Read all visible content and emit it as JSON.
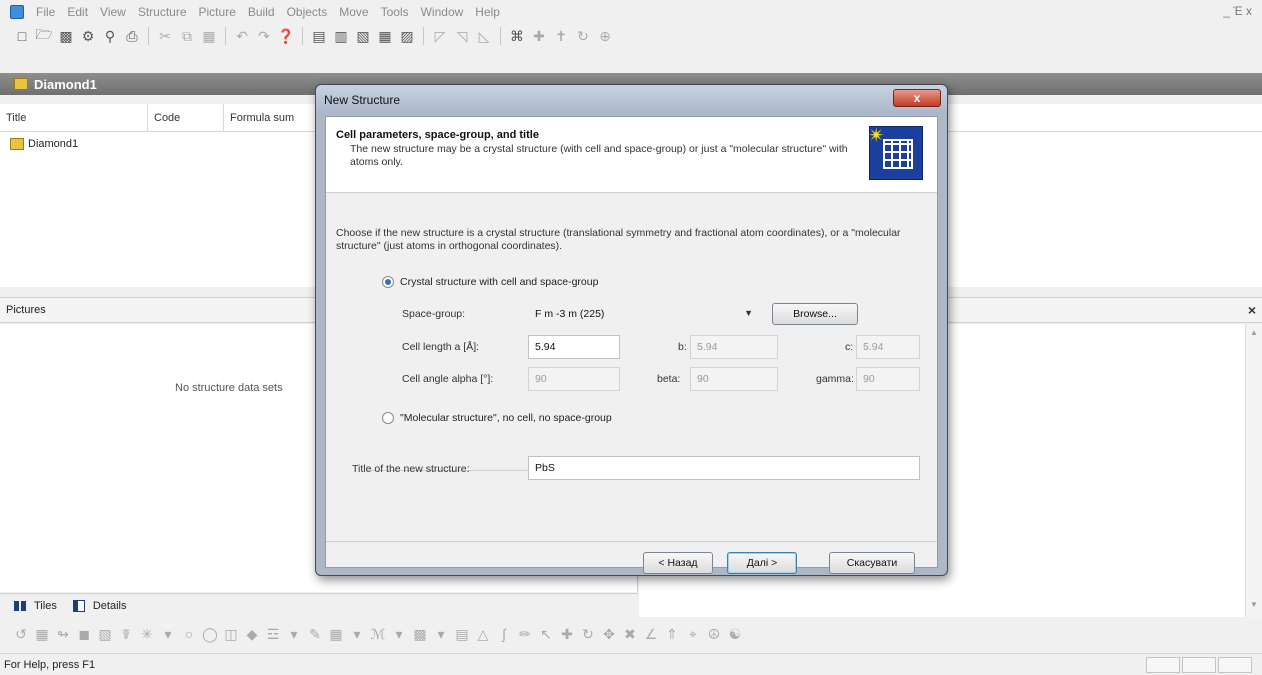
{
  "menubar": {
    "items": [
      "File",
      "Edit",
      "View",
      "Structure",
      "Picture",
      "Build",
      "Objects",
      "Move",
      "Tools",
      "Window",
      "Help"
    ],
    "window_controls": "_ Έ x"
  },
  "document": {
    "title": "Diamond1",
    "columns": [
      "Title",
      "Code",
      "Formula sum"
    ],
    "rows": [
      {
        "title": "Diamond1"
      }
    ]
  },
  "pictures": {
    "title": "Pictures",
    "empty_message": "No structure data sets",
    "tabs": [
      "Tiles",
      "Details"
    ]
  },
  "status": {
    "text": "For Help, press F1"
  },
  "dialog": {
    "title": "New Structure",
    "close_label": "x",
    "header_title": "Cell parameters, space-group, and title",
    "header_desc": "The new structure may be a crystal structure (with cell and space-group) or just a \"molecular structure\" with atoms only.",
    "body_text": "Choose if the new structure is a crystal structure (translational symmetry and fractional atom coordinates), or a \"molecular structure\" (just atoms in orthogonal coordinates).",
    "radio_crystal": "Crystal structure with cell and space-group",
    "radio_molecular": "\"Molecular structure\", no cell, no space-group",
    "space_group_label": "Space-group:",
    "space_group_value": "F m -3 m (225)",
    "browse_label": "Browse...",
    "cell_length_label": "Cell length a [Å]:",
    "a_value": "5.94",
    "b_label": "b:",
    "b_value": "5.94",
    "c_label": "c:",
    "c_value": "5.94",
    "cell_angle_label": "Cell angle alpha [°]:",
    "alpha_value": "90",
    "beta_label": "beta:",
    "beta_value": "90",
    "gamma_label": "gamma:",
    "gamma_value": "90",
    "title_label": "Title of the new structure:",
    "title_value": "PbS",
    "back_label": "< Назад",
    "next_label": "Далі >",
    "cancel_label": "Скасувати"
  }
}
